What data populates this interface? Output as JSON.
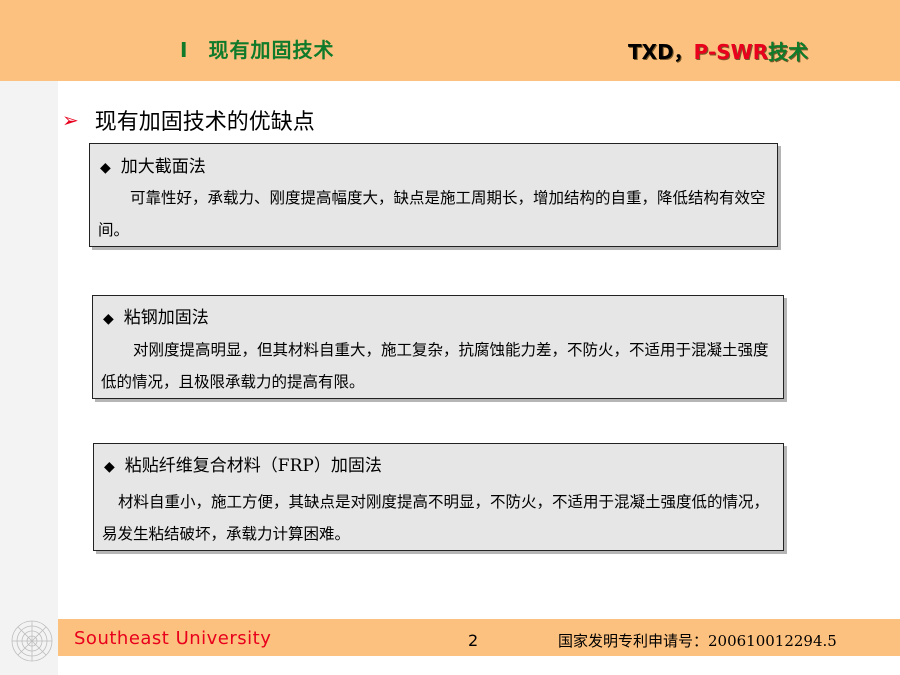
{
  "header": {
    "section_number": "I",
    "section_title": "现有加固技术",
    "brand_txd": "TXD",
    "brand_sep": "，",
    "brand_pswr": "P-SWR",
    "brand_tech": "技术"
  },
  "main": {
    "heading": "现有加固技术的优缺点",
    "methods": [
      {
        "title": "加大截面法",
        "description": "可靠性好，承载力、刚度提高幅度大，缺点是施工周期长，增加结构的自重，降低结构有效空间。"
      },
      {
        "title": "粘钢加固法",
        "description": "对刚度提高明显，但其材料自重大，施工复杂，抗腐蚀能力差，不防火，不适用于混凝土强度低的情况，且极限承载力的提高有限。"
      },
      {
        "title": "粘贴纤维复合材料（FRP）加固法",
        "description": "材料自重小，施工方便，其缺点是对刚度提高不明显，不防火，不适用于混凝土强度低的情况，易发生粘结破坏，承载力计算困难。"
      }
    ]
  },
  "footer": {
    "university": "Southeast  University",
    "page_number": "2",
    "patent": "国家发明专利申请号：200610012294.5"
  },
  "colors": {
    "header_bg": "#fdc17f",
    "title_green": "#0f7a2a",
    "accent_red": "#e8001c",
    "box_bg": "#e6e6e6"
  },
  "icons": {
    "bullet": "arrow-right-icon",
    "item_marker": "diamond-icon",
    "logo": "university-logo-icon"
  }
}
